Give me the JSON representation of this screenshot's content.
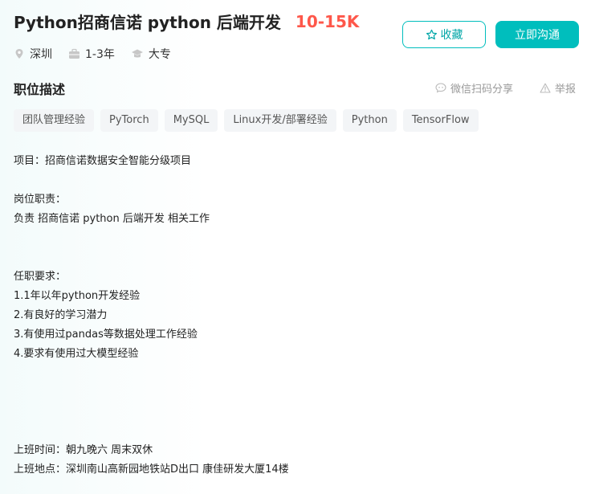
{
  "job": {
    "title": "Python招商信诺 python 后端开发",
    "salary": "10-15K",
    "city": "深圳",
    "experience": "1-3年",
    "education": "大专"
  },
  "actions": {
    "collect_label": "收藏",
    "chat_label": "立即沟通"
  },
  "section": {
    "title": "职位描述",
    "share_label": "微信扫码分享",
    "report_label": "举报"
  },
  "tags": [
    "团队管理经验",
    "PyTorch",
    "MySQL",
    "Linux开发/部署经验",
    "Python",
    "TensorFlow"
  ],
  "description": {
    "project": "项目：招商信诺数据安全智能分级项目",
    "duties_title": "岗位职责：",
    "duties": "负责 招商信诺 python 后端开发 相关工作",
    "requirements_title": "任职要求：",
    "requirements": [
      "1.1年以年python开发经验",
      "2.有良好的学习潜力",
      "3.有使用过pandas等数据处理工作经验",
      "4.要求有使用过大模型经验"
    ],
    "work_time": "上班时间：朝九晚六   周末双休",
    "work_place": "上班地点：深圳南山高新园地铁站D出口 康佳研发大厦14楼"
  },
  "colors": {
    "accent": "#00bebd",
    "salary": "#fe574a"
  }
}
